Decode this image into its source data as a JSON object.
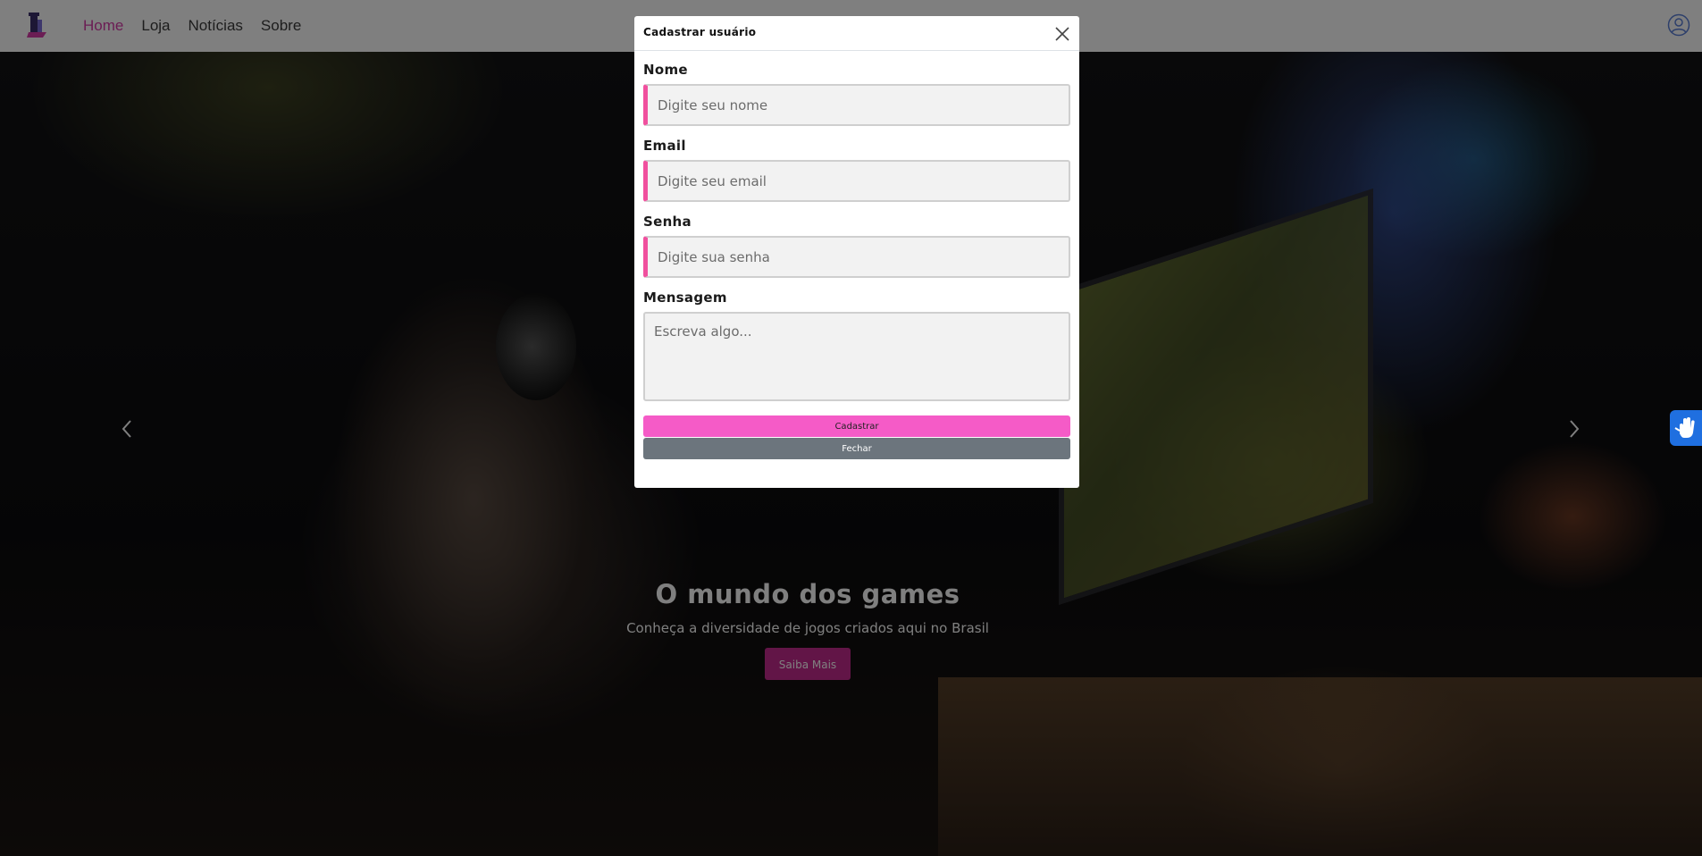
{
  "navbar": {
    "logo_icon": "brand-logo-icon",
    "links": [
      {
        "label": "Home",
        "active": true
      },
      {
        "label": "Loja",
        "active": false
      },
      {
        "label": "Notícias",
        "active": false
      },
      {
        "label": "Sobre",
        "active": false
      }
    ],
    "user_icon": "user-circle-icon",
    "active_color": "#d63aa8"
  },
  "hero": {
    "title": "O mundo dos games",
    "subtitle": "Conheça a diversidade de jogos criados aqui no Brasil",
    "button_label": "Saiba Mais",
    "button_color": "#c42b8f",
    "prev_icon": "chevron-left-icon",
    "next_icon": "chevron-right-icon"
  },
  "accessibility_widget": {
    "icon": "sign-language-hand-icon",
    "color": "#1f6fe0"
  },
  "modal": {
    "title": "Cadastrar usuário",
    "close_icon": "close-icon",
    "fields": {
      "name": {
        "label": "Nome",
        "placeholder": "Digite seu nome"
      },
      "email": {
        "label": "Email",
        "placeholder": "Digite seu email"
      },
      "password": {
        "label": "Senha",
        "placeholder": "Digite sua senha"
      },
      "message": {
        "label": "Mensagem",
        "placeholder": "Escreva algo..."
      }
    },
    "submit_label": "Cadastrar",
    "dismiss_label": "Fechar",
    "accent_color": "#f0509e",
    "submit_color": "#f55bc7",
    "dismiss_color": "#6c757d"
  }
}
